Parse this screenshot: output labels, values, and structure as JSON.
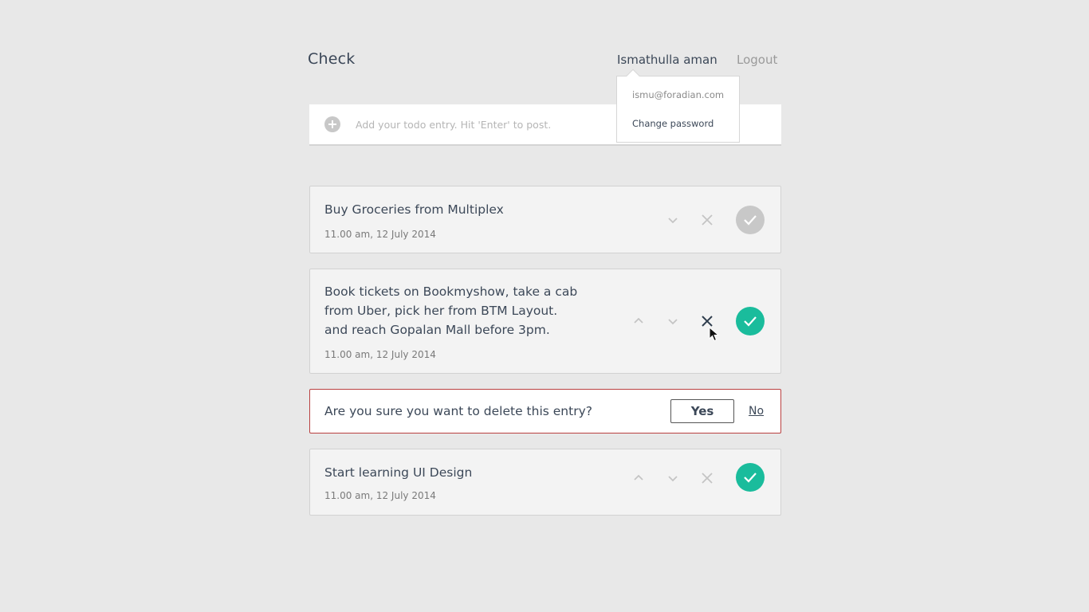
{
  "header": {
    "title": "Check",
    "user_name": "Ismathulla aman",
    "logout_label": "Logout"
  },
  "user_menu": {
    "email": "ismu@foradian.com",
    "change_password_label": "Change password"
  },
  "composer": {
    "placeholder": "Add your todo entry. Hit 'Enter' to post.",
    "value": ""
  },
  "todos": [
    {
      "lines": [
        "Buy Groceries from Multiplex"
      ],
      "date": "11.00 am, 12 July 2014",
      "done_style": "inactive"
    },
    {
      "lines": [
        "Book tickets on Bookmyshow, take a cab",
        "from Uber, pick her from BTM Layout.",
        "and reach Gopalan Mall before 3pm."
      ],
      "date": "11.00 am, 12 July 2014",
      "done_style": "active"
    },
    {
      "lines": [
        "Start learning UI Design"
      ],
      "date": "11.00 am, 12 July 2014",
      "done_style": "active"
    }
  ],
  "confirm": {
    "question": "Are you sure you want to delete this entry?",
    "yes_label": "Yes",
    "no_label": "No"
  },
  "colors": {
    "accent": "#1abc9c",
    "done_inactive": "#c8c8c8",
    "delete_border": "#b94040",
    "icon_muted": "#c4c4c4",
    "icon_hover": "#2f3e4e"
  },
  "icons": {
    "add": "plus-circle-icon",
    "move_up": "chevron-up-icon",
    "move_down": "chevron-down-icon",
    "delete": "close-icon",
    "done": "checkmark-icon"
  }
}
